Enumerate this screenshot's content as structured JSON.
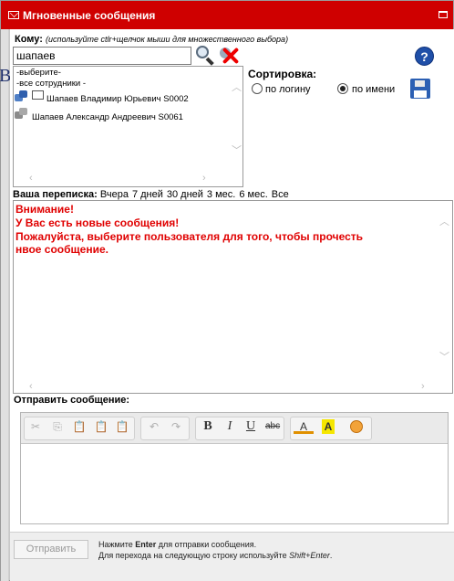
{
  "window": {
    "title": "Мгновенные сообщения"
  },
  "background_glyph": "В",
  "recipient": {
    "label": "Кому:",
    "hint": "(используйте ctlr+щелчок мыши для множественного выбора)",
    "search_value": "шапаев"
  },
  "list": {
    "items": [
      "-выберите-",
      "-все сотрудники -",
      "Шапаев Владимир Юрьевич S0002",
      "Шапаев Александр Андреевич S0061"
    ]
  },
  "sort": {
    "label": "Сортировка:",
    "options": [
      "по логину",
      "по имени"
    ],
    "selected": "по имени"
  },
  "correspondence": {
    "label": "Ваша переписка:",
    "periods": [
      "Вчера",
      "7 дней",
      "30 дней",
      "3 мес.",
      "6 мес.",
      "Все"
    ]
  },
  "messages": {
    "lines": [
      "Внимание!",
      "У Вас есть новые сообщения!",
      "Пожалуйста, выберите пользователя для того, чтобы прочесть",
      "нвое сообщение."
    ],
    "color": "#e00000"
  },
  "compose": {
    "label": "Отправить сообщение:",
    "toolbar": {
      "bold": "B",
      "italic": "I",
      "underline": "U",
      "strike": "abc",
      "font_color": "A",
      "highlight": "A",
      "undo": "↶",
      "redo": "↷"
    }
  },
  "footer": {
    "send_button": "Отправить",
    "hint_line1_pre": "Нажмите ",
    "hint_line1_key": "Enter",
    "hint_line1_post": " для отправки сообщения.",
    "hint_line2_pre": "Для перехода на следующую строку используйте ",
    "hint_line2_key": "Shift+Enter",
    "hint_line2_post": "."
  },
  "colors": {
    "title_bar": "#cf0000",
    "alert_text": "#e00000",
    "help_icon": "#1f4fa8"
  }
}
